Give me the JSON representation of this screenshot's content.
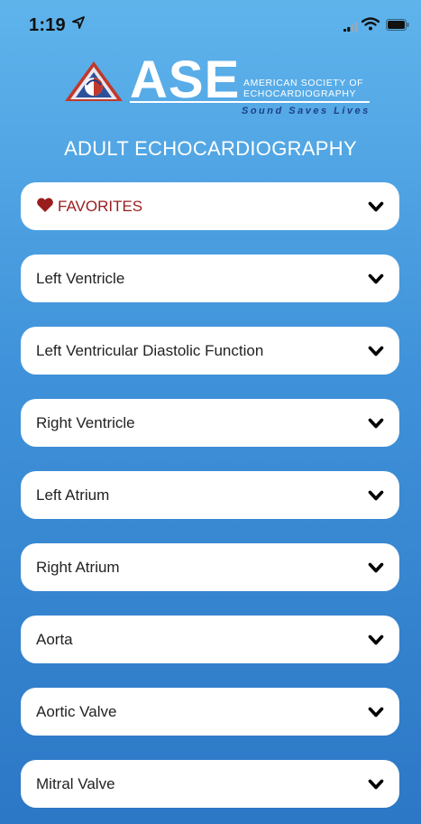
{
  "status_bar": {
    "time": "1:19"
  },
  "header": {
    "logo_text": "ASE",
    "org_line1": "AMERICAN SOCIETY OF",
    "org_line2": "ECHOCARDIOGRAPHY",
    "tagline": "Sound Saves Lives",
    "title": "ADULT ECHOCARDIOGRAPHY"
  },
  "menu": {
    "favorites_label": "FAVORITES",
    "items": [
      {
        "label": "Left Ventricle"
      },
      {
        "label": "Left Ventricular Diastolic Function"
      },
      {
        "label": "Right Ventricle"
      },
      {
        "label": "Left Atrium"
      },
      {
        "label": "Right Atrium"
      },
      {
        "label": "Aorta"
      },
      {
        "label": "Aortic Valve"
      },
      {
        "label": "Mitral Valve"
      }
    ]
  },
  "colors": {
    "background_top": "#5fb4ec",
    "background_bottom": "#2c77c6",
    "favorites": "#9a1d1d",
    "row_bg": "#ffffff",
    "tagline": "#1d3f87"
  },
  "icons": [
    "location-arrow-icon",
    "signal-icon",
    "wifi-icon",
    "battery-icon",
    "heart-icon",
    "chevron-down-icon"
  ]
}
